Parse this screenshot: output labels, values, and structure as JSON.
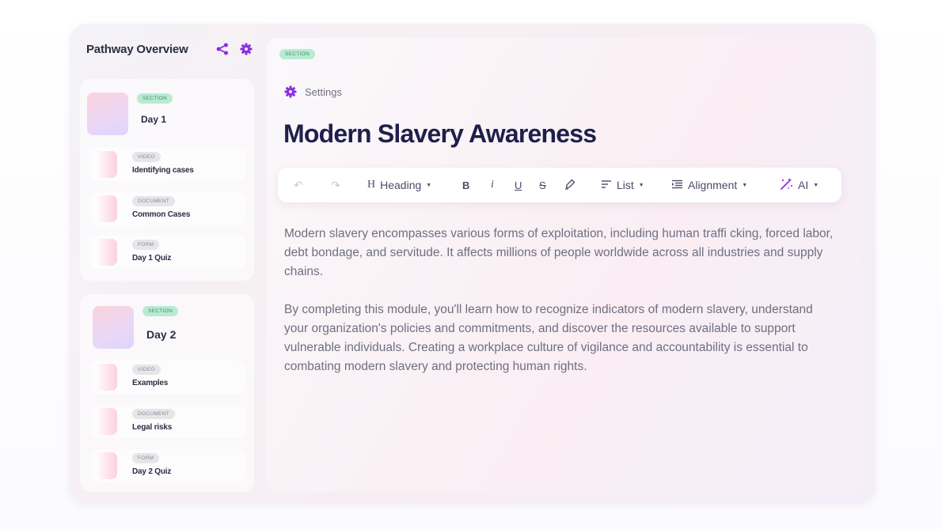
{
  "sidebar": {
    "title": "Pathway Overview",
    "sections": [
      {
        "badge": "SECTION",
        "title": "Day 1",
        "items": [
          {
            "type": "VIDEO",
            "label": "Identifying cases"
          },
          {
            "type": "DOCUMENT",
            "label": "Common Cases"
          },
          {
            "type": "FORM",
            "label": "Day 1 Quiz"
          }
        ]
      },
      {
        "badge": "SECTION",
        "title": "Day 2",
        "items": [
          {
            "type": "VIDEO",
            "label": "Examples"
          },
          {
            "type": "DOCUMENT",
            "label": "Legal risks"
          },
          {
            "type": "FORM",
            "label": "Day 2 Quiz"
          }
        ]
      }
    ]
  },
  "main": {
    "badge": "SECTION",
    "settings_label": "Settings",
    "title": "Modern Slavery Awareness",
    "toolbar": {
      "undo": "↶",
      "redo": "↷",
      "heading_icon": "H",
      "heading_label": "Heading",
      "bold": "B",
      "italic": "i",
      "underline": "U",
      "strike": "S",
      "list_label": "List",
      "alignment_label": "Alignment",
      "ai_label": "AI"
    },
    "paragraphs": [
      "Modern slavery encompasses various forms of exploitation, including human traffi  cking, forced labor, debt bondage, and servitude. It affects millions of people worldwide across all industries and supply chains.",
      "By completing this module, you'll learn how to recognize indicators of modern slavery, understand your organization's policies and commitments, and discover the resources available to support vulnerable individuals. Creating a workplace culture of vigilance and accountability is essential to combating modern slavery and protecting human rights."
    ]
  },
  "colors": {
    "accent": "#8b2be2",
    "title": "#1e1f4b",
    "section_badge_bg": "#b9ebd3",
    "type_badge_bg": "#e6e5e9"
  }
}
